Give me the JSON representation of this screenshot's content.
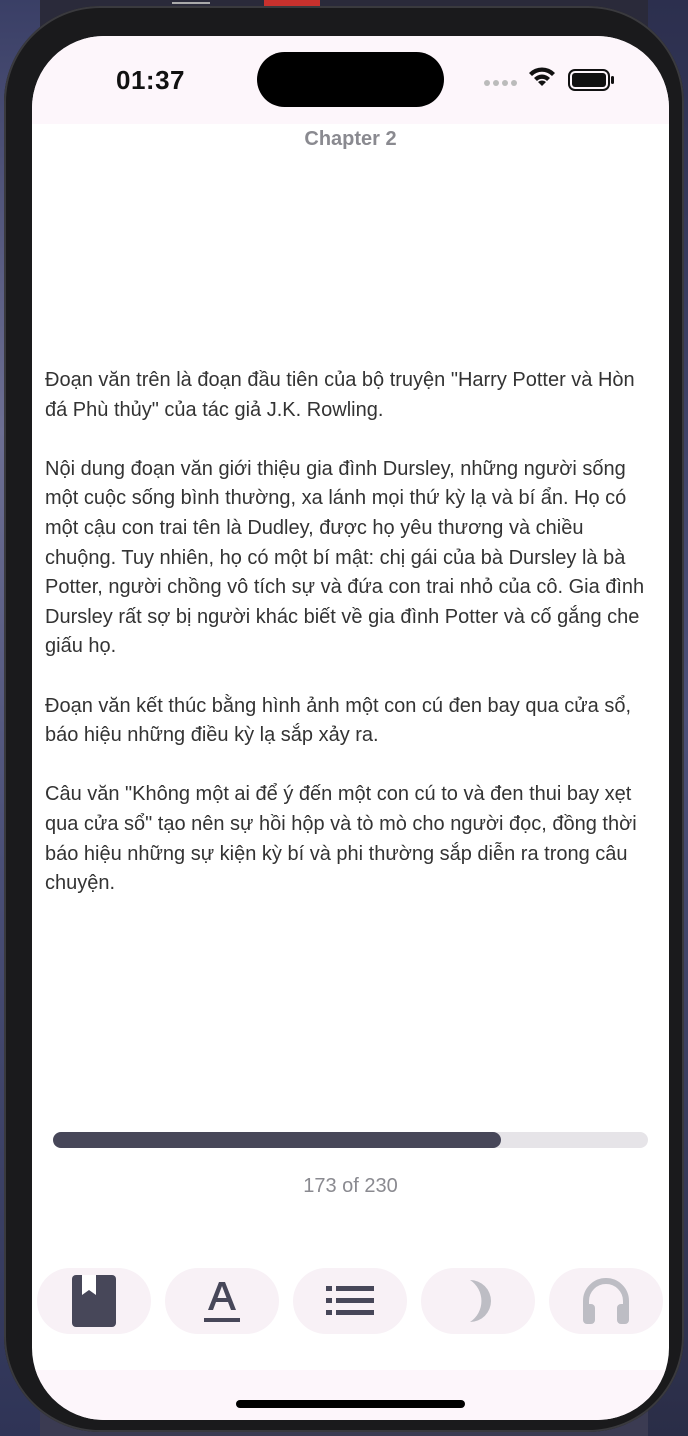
{
  "status_bar": {
    "time": "01:37"
  },
  "reader": {
    "chapter_title": "Chapter 2",
    "paragraphs": [
      "Đoạn văn trên là đoạn đầu tiên của bộ truyện \"Harry Potter và Hòn đá Phù thủy\" của tác giả J.K. Rowling.",
      "Nội dung đoạn văn giới thiệu gia đình Dursley, những người sống một cuộc sống bình thường, xa lánh mọi thứ kỳ lạ và bí ẩn. Họ có một cậu con trai tên là Dudley, được họ yêu thương và chiều chuộng. Tuy nhiên, họ có một bí mật: chị gái của bà Dursley là bà Potter, người chồng vô tích sự và đứa con trai nhỏ của cô. Gia đình Dursley rất sợ bị người khác biết về gia đình Potter và cố gắng che giấu họ.",
      "Đoạn văn kết thúc bằng hình ảnh một con cú đen bay qua cửa sổ, báo hiệu những điều kỳ lạ sắp xảy ra.",
      "Câu văn \"Không một ai để ý đến một con cú to và đen thui bay xẹt qua cửa sổ\" tạo nên sự hồi hộp và tò mò cho người đọc, đồng thời báo hiệu những sự kiện kỳ bí và phi thường sắp diễn ra trong câu chuyện."
    ],
    "progress": {
      "current_page": 173,
      "total_pages": 230,
      "label": "173 of 230"
    }
  },
  "toolbar": {
    "buttons": [
      {
        "icon": "bookmark-icon"
      },
      {
        "icon": "font-icon"
      },
      {
        "icon": "list-icon"
      },
      {
        "icon": "moon-icon"
      },
      {
        "icon": "headphones-icon"
      }
    ]
  },
  "colors": {
    "accent": "#474759",
    "track": "#e6e4e8",
    "toolbar_button_bg": "#f8f1f6",
    "muted_text": "#8a8a90",
    "body_text": "#333333"
  }
}
